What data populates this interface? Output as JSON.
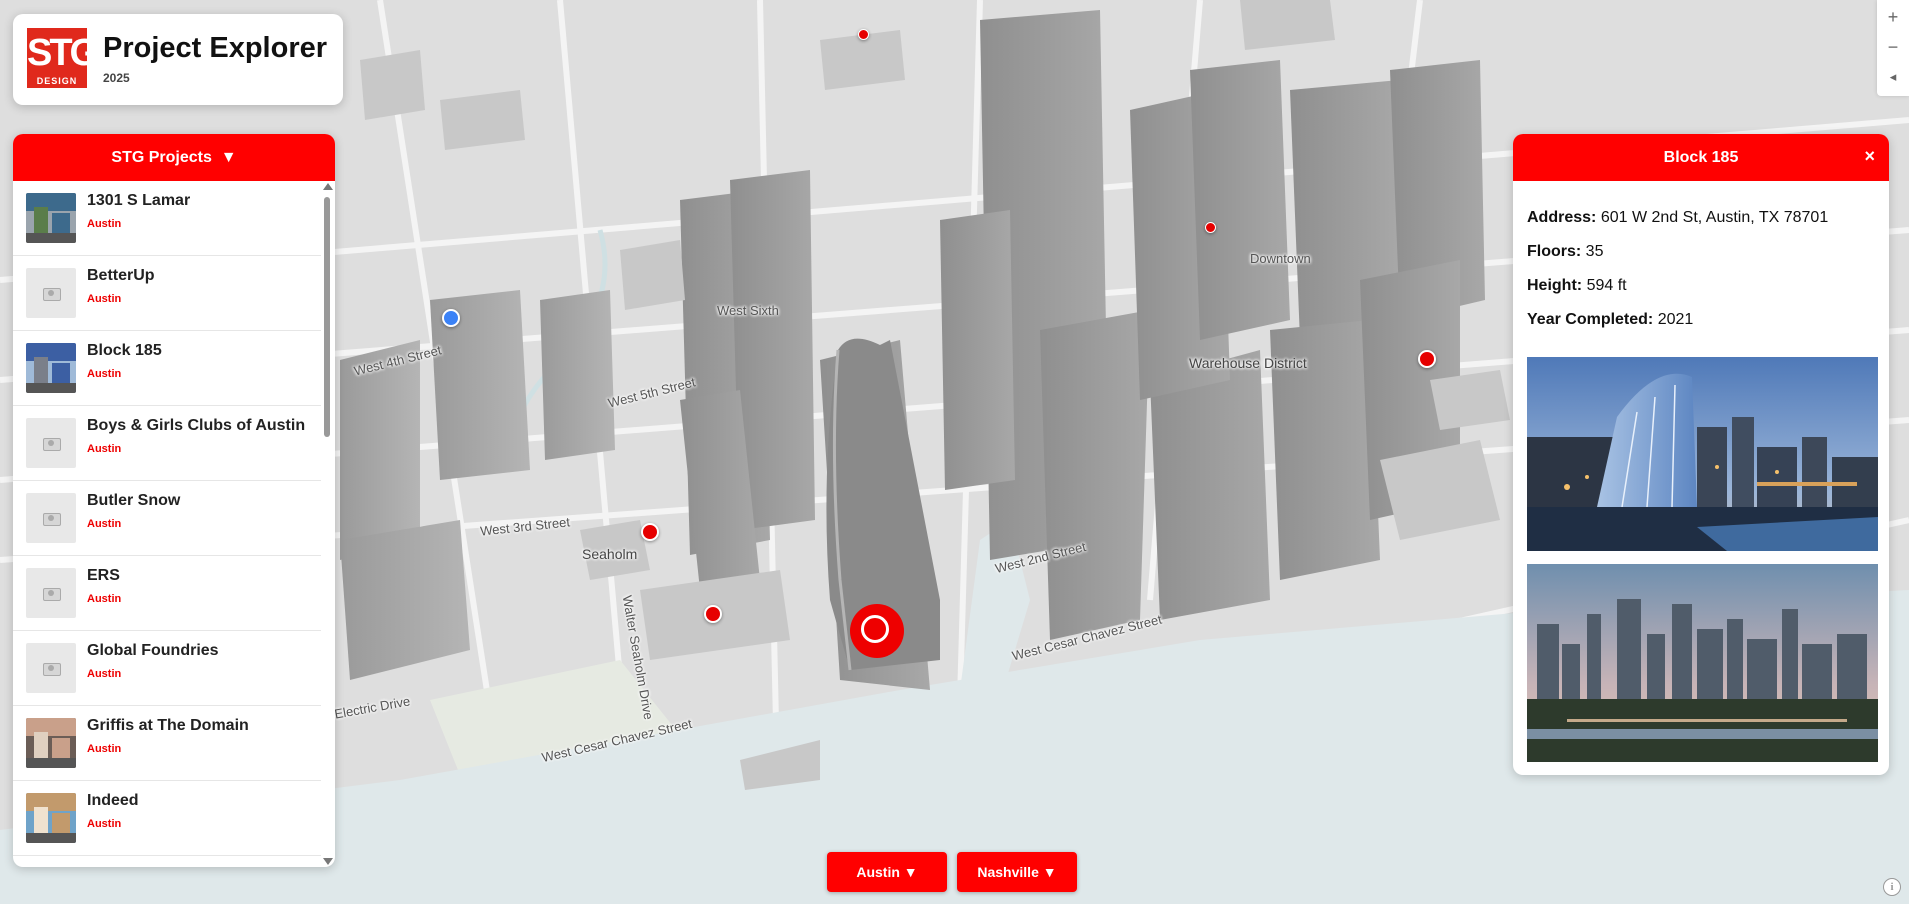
{
  "app": {
    "logo_text": "STG",
    "logo_sub": "DESIGN",
    "title": "Project Explorer",
    "year": "2025"
  },
  "colors": {
    "accent": "#ff0000",
    "marker_red": "#e60000",
    "marker_blue": "#3b82f6",
    "water": "#dfe8ea"
  },
  "project_list": {
    "header": "STG Projects",
    "dropdown_icon": "caret-down-icon",
    "items": [
      {
        "name": "1301 S Lamar",
        "city": "Austin",
        "thumb": "photo"
      },
      {
        "name": "BetterUp",
        "city": "Austin",
        "thumb": "placeholder"
      },
      {
        "name": "Block 185",
        "city": "Austin",
        "thumb": "photo"
      },
      {
        "name": "Boys & Girls Clubs of Austin",
        "city": "Austin",
        "thumb": "placeholder"
      },
      {
        "name": "Butler Snow",
        "city": "Austin",
        "thumb": "placeholder"
      },
      {
        "name": "ERS",
        "city": "Austin",
        "thumb": "placeholder"
      },
      {
        "name": "Global Foundries",
        "city": "Austin",
        "thumb": "placeholder"
      },
      {
        "name": "Griffis at The Domain",
        "city": "Austin",
        "thumb": "photo"
      },
      {
        "name": "Indeed",
        "city": "Austin",
        "thumb": "photo"
      }
    ]
  },
  "detail": {
    "title": "Block 185",
    "close_label": "×",
    "address_label": "Address:",
    "address": "601 W 2nd St, Austin, TX 78701",
    "floors_label": "Floors:",
    "floors": "35",
    "height_label": "Height:",
    "height": "594 ft",
    "year_label": "Year Completed:",
    "year": "2021"
  },
  "map_labels": {
    "downtown": "Downtown",
    "warehouse": "Warehouse District",
    "west_sixth": "West Sixth",
    "seaholm": "Seaholm",
    "cesar_chavez": "West Cesar Chavez Street",
    "electric": "Electric Drive",
    "w_third": "West 3rd Street",
    "w_second": "West 2nd Street",
    "walter_seaholm": "Walter Seaholm Drive",
    "w_fifth": "West 5th Street",
    "w_fourth": "West 4th Street"
  },
  "city_buttons": [
    {
      "label": "Austin ▼"
    },
    {
      "label": "Nashville ▼"
    }
  ],
  "zoom": {
    "in": "+",
    "out": "−",
    "compass": "◂",
    "info": "i"
  }
}
